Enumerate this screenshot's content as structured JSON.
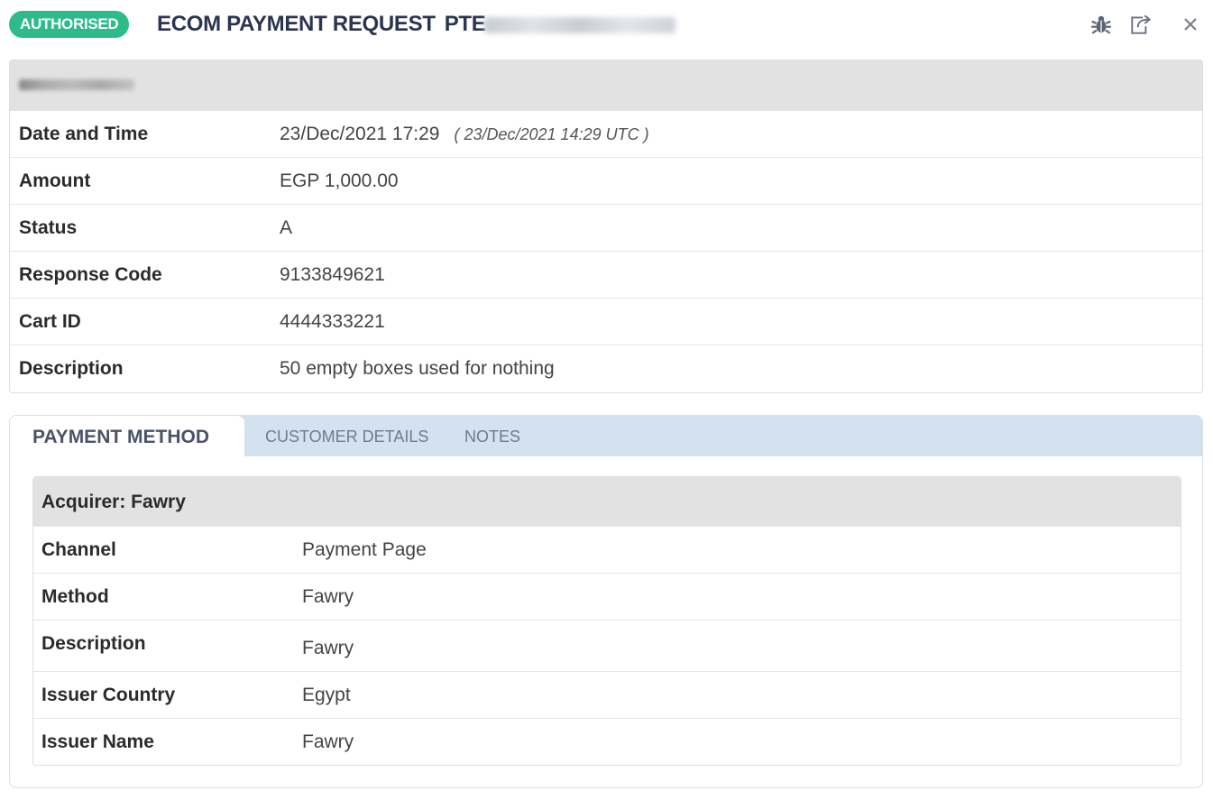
{
  "header": {
    "status_badge": "AUTHORISED",
    "title": "ECOM PAYMENT REQUEST",
    "ref_prefix": "PTE",
    "icons": [
      "bug-icon",
      "share-icon",
      "close-icon"
    ],
    "close_glyph": "×"
  },
  "colors": {
    "badge": "#2dbb8a",
    "title": "#2a3550",
    "tab_strip": "#d3e2ee",
    "section_header": "#e2e2e2"
  },
  "summary": {
    "rows": [
      {
        "label": "Date and Time",
        "value": "23/Dec/2021 17:29",
        "utc": "( 23/Dec/2021 14:29 UTC )"
      },
      {
        "label": "Amount",
        "value": "EGP 1,000.00"
      },
      {
        "label": "Status",
        "value": "A"
      },
      {
        "label": "Response Code",
        "value": "9133849621"
      },
      {
        "label": "Cart ID",
        "value": "4444333221"
      },
      {
        "label": "Description",
        "value": "50 empty boxes used for nothing"
      }
    ]
  },
  "tabs": [
    {
      "label": "PAYMENT METHOD",
      "active": true
    },
    {
      "label": "CUSTOMER DETAILS",
      "active": false
    },
    {
      "label": "NOTES",
      "active": false
    }
  ],
  "payment_method": {
    "acquirer": "Acquirer: Fawry",
    "rows": [
      {
        "label": "Channel",
        "value": "Payment Page"
      },
      {
        "label": "Method",
        "value": "Fawry"
      },
      {
        "label": "Description",
        "value": "Fawry"
      },
      {
        "label": "Issuer Country",
        "value": "Egypt"
      },
      {
        "label": "Issuer Name",
        "value": "Fawry"
      }
    ]
  }
}
